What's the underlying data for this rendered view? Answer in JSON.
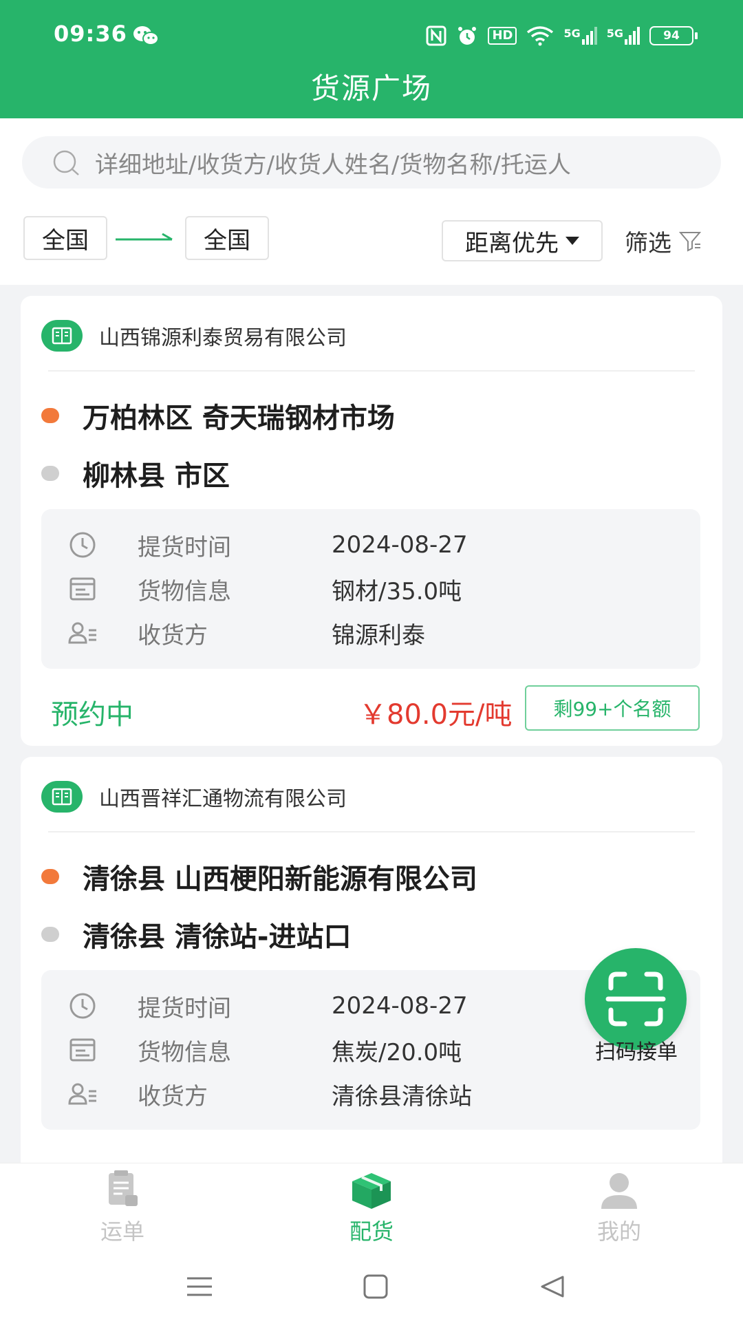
{
  "status_bar": {
    "time": "09:36",
    "icons": [
      "wechat-icon",
      "nfc-icon",
      "alarm-icon",
      "hd-icon",
      "wifi-icon",
      "5g-signal-icon",
      "5g-signal-icon"
    ],
    "hd_label": "HD",
    "network_1": "5G",
    "network_2": "5G",
    "battery": "94"
  },
  "header": {
    "title": "货源广场"
  },
  "search": {
    "placeholder": "详细地址/收货方/收货人姓名/货物名称/托运人"
  },
  "filters": {
    "from_region": "全国",
    "to_region": "全国",
    "sort_label": "距离优先",
    "filter_label": "筛选"
  },
  "cards": [
    {
      "company": "山西锦源利泰贸易有限公司",
      "origin": "万柏林区 奇天瑞钢材市场",
      "destination": "柳林县 市区",
      "info": [
        {
          "label": "提货时间",
          "value": "2024-08-27"
        },
        {
          "label": "货物信息",
          "value": "钢材/35.0吨"
        },
        {
          "label": "收货方",
          "value": "锦源利泰"
        }
      ],
      "status": "预约中",
      "price": "￥80.0元/吨",
      "quota": "剩99+个名额"
    },
    {
      "company": "山西晋祥汇通物流有限公司",
      "origin": "清徐县 山西梗阳新能源有限公司",
      "destination": "清徐县 清徐站-进站口",
      "info": [
        {
          "label": "提货时间",
          "value": "2024-08-27"
        },
        {
          "label": "货物信息",
          "value": "焦炭/20.0吨"
        },
        {
          "label": "收货方",
          "value": "清徐县清徐站"
        }
      ]
    }
  ],
  "scan": {
    "label": "扫码接单"
  },
  "bottom_nav": [
    {
      "label": "运单",
      "active": false
    },
    {
      "label": "配货",
      "active": true
    },
    {
      "label": "我的",
      "active": false
    }
  ],
  "colors": {
    "primary": "#27b46a",
    "price": "#e33a2f",
    "origin_dot": "#f2793b",
    "destination_dot": "#cfcfcf"
  }
}
